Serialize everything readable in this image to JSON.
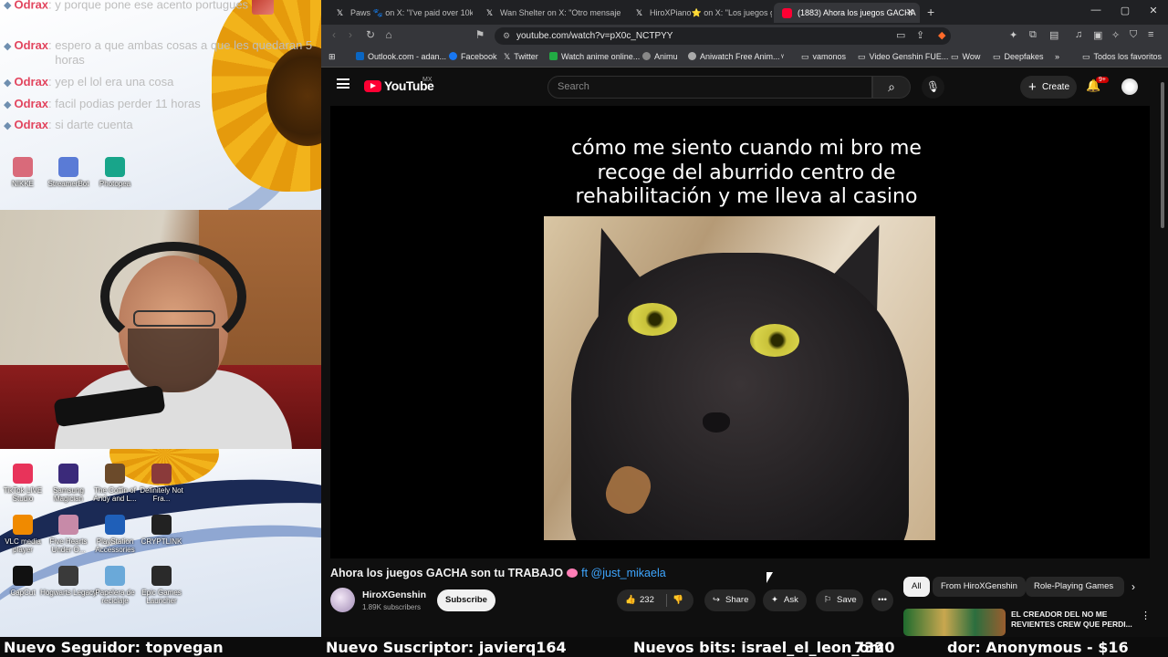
{
  "stream_overlay": {
    "chat": [
      {
        "user": "Odrax",
        "message": "y porque pone ese acento portugues",
        "has_emote": true
      },
      {
        "user": "Odrax",
        "message": "espero a que ambas cosas a que les quedaran 5 horas"
      },
      {
        "user": "Odrax",
        "message": "yep el lol era una cosa"
      },
      {
        "user": "Odrax",
        "message": "facil podias perder 11 horas"
      },
      {
        "user": "Odrax",
        "message": "si darte cuenta"
      }
    ],
    "desktop_icons_top": [
      {
        "label": "NIKKE",
        "color": "#d96a7a"
      },
      {
        "label": "StreamerBot",
        "color": "#5a7bd6"
      },
      {
        "label": "Photopea",
        "color": "#18a58a"
      }
    ],
    "desktop_icons_bottom": [
      {
        "label": "TikTok LIVE Studio",
        "color": "#e8335a"
      },
      {
        "label": "Samsung Magician",
        "color": "#3b2a7a"
      },
      {
        "label": "The Coffin of Andy and L...",
        "color": "#6b4a2a"
      },
      {
        "label": "Definitely Not Fra...",
        "color": "#8a3a3a"
      },
      {
        "label": "VLC media player",
        "color": "#f08a00"
      },
      {
        "label": "Five Hearts Under O...",
        "color": "#c78aa8"
      },
      {
        "label": "PlayStation Accessories",
        "color": "#1f5fb8"
      },
      {
        "label": "CRYPTLINK",
        "color": "#222222"
      },
      {
        "label": "CapCut",
        "color": "#111111"
      },
      {
        "label": "Hogwarts Legacy",
        "color": "#3a3a3a"
      },
      {
        "label": "Papelera de reciclaje",
        "color": "#6aa9d9"
      },
      {
        "label": "Epic Games Launcher",
        "color": "#2a2a2a"
      }
    ]
  },
  "browser": {
    "tabs": [
      {
        "label": "Paws 🐾 on X: \"I've paid over 10k",
        "icon": "x-icon",
        "active": false
      },
      {
        "label": "Wan Shelter on X: \"Otro mensaje de",
        "icon": "x-icon",
        "active": false
      },
      {
        "label": "HiroXPiano⭐ on X: \"Los juegos gac",
        "icon": "x-icon",
        "active": false
      },
      {
        "label": "(1883) Ahora los juegos GACHA",
        "icon": "youtube-icon",
        "active": true
      }
    ],
    "url": "youtube.com/watch?v=pX0c_NCTPYY",
    "bookmarks": [
      {
        "label": "Outlook.com - adan...",
        "color": "#0a66c2"
      },
      {
        "label": "Facebook",
        "color": "#1877f2"
      },
      {
        "label": "Twitter",
        "color": "#ffffff"
      },
      {
        "label": "Watch anime online...",
        "color": "#22aa44"
      },
      {
        "label": "Animu",
        "color": "#888888"
      },
      {
        "label": "Aniwatch Free Anim...",
        "color": "#aaaaaa"
      },
      {
        "label": "",
        "color": "#cccccc"
      },
      {
        "label": "vamonos",
        "color": "#dddddd"
      },
      {
        "label": "Video Genshin FUE...",
        "color": "#dddddd"
      },
      {
        "label": "Wow",
        "color": "#dddddd"
      },
      {
        "label": "Deepfakes",
        "color": "#dddddd"
      }
    ],
    "bookmarks_more": "»",
    "all_bookmarks": "Todos los favoritos"
  },
  "youtube": {
    "logo_text": "YouTube",
    "region": "MX",
    "search_placeholder": "Search",
    "create_label": "Create",
    "notifications_badge": "9+",
    "video_caption": "cómo me siento cuando mi bro me recoge del aburrido centro de rehabilitación y me lleva al casino",
    "video_title": "Ahora los juegos GACHA son tu TRABAJO",
    "video_title_mention": "ft @just_mikaela",
    "channel_name": "HiroXGenshin",
    "channel_subs": "1.89K subscribers",
    "subscribe_label": "Subscribe",
    "likes": "232",
    "share_label": "Share",
    "ask_label": "Ask",
    "save_label": "Save",
    "chips": [
      "All",
      "From HiroXGenshin",
      "Role-Playing Games"
    ],
    "recommendation_title": "EL CREADOR DEL NO ME REVIENTES CREW QUE PERDI..."
  },
  "ticker": {
    "follower": "Nuevo Seguidor: topvegan",
    "subscriber": "Nuevo Suscriptor: javierq164",
    "bits": "Nuevos bits: israel_el_leon_om",
    "extra": "7320",
    "donor": "dor: Anonymous - $16"
  },
  "colors": {
    "youtube_red": "#ff0033",
    "mention_blue": "#3ea6ff",
    "chat_user": "#e2455e"
  }
}
